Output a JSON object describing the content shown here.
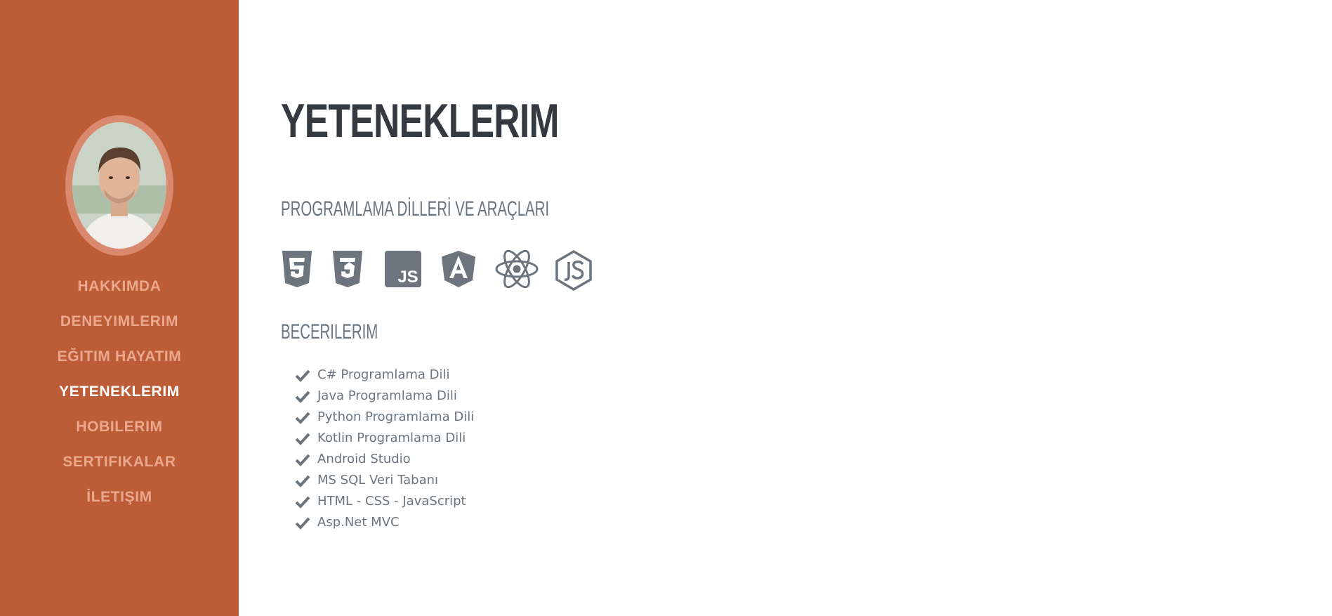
{
  "sidebar": {
    "accent_color": "#bd5d38",
    "nav": [
      {
        "label": "HAKKIMDA",
        "active": false
      },
      {
        "label": "DENEYIMLERIM",
        "active": false
      },
      {
        "label": "EĞITIM HAYATIM",
        "active": false
      },
      {
        "label": "YETENEKLERIM",
        "active": true
      },
      {
        "label": "HOBILERIM",
        "active": false
      },
      {
        "label": "SERTIFIKALAR",
        "active": false
      },
      {
        "label": "İLETIŞIM",
        "active": false
      }
    ]
  },
  "main": {
    "title": "YETENEKLERIM",
    "languages_heading": "PROGRAMLAMA DİLLERİ VE ARAÇLARI",
    "tool_icons": [
      "html5-icon",
      "css3-icon",
      "javascript-icon",
      "angular-icon",
      "react-icon",
      "nodejs-icon"
    ],
    "skills_heading": "BECERILERIM",
    "skills": [
      "C# Programlama Dili",
      "Java Programlama Dili",
      "Python Programlama Dili",
      "Kotlin Programlama Dili",
      "Android Studio",
      "MS SQL Veri Tabanı",
      "HTML - CSS - JavaScript",
      "Asp.Net MVC"
    ]
  }
}
